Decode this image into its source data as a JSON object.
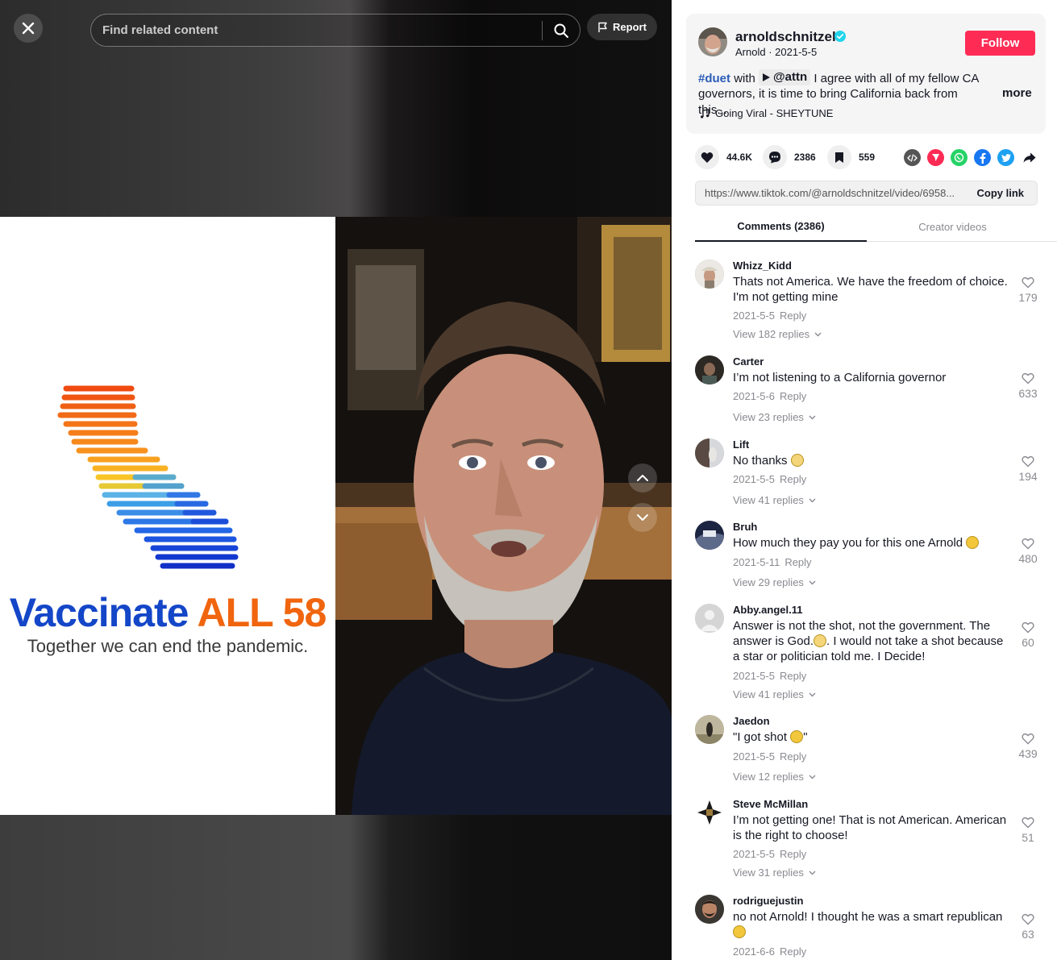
{
  "player": {
    "search_placeholder": "Find related content",
    "report_label": "Report",
    "video": {
      "campaign_title_part1": "Vaccinate",
      "campaign_title_part2": "ALL 58",
      "campaign_subtitle": "Together we can end the pandemic."
    }
  },
  "post": {
    "author": "arnoldschnitzel",
    "display_name": "Arnold",
    "date": "2021-5-5",
    "follow_label": "Follow",
    "caption_hashtag": "#duet",
    "caption_with": "with",
    "caption_mention": "@attn",
    "caption_text": "I agree with all of my fellow CA governors, it is time to bring California back from this...",
    "more_label": "more",
    "music": "Going Viral - SHEYTUNE",
    "likes": "44.6K",
    "comments_count": "2386",
    "bookmarks": "559",
    "share_targets": [
      "embed-icon",
      "send-icon",
      "whatsapp-icon",
      "facebook-icon",
      "twitter-icon",
      "share-arrow-icon"
    ],
    "link": "https://www.tiktok.com/@arnoldschnitzel/video/6958...",
    "copy_link_label": "Copy link"
  },
  "tabs": {
    "comments": "Comments (2386)",
    "creator": "Creator videos"
  },
  "comments": [
    {
      "user": "Whizz_Kidd",
      "text": "Thats not America. We have the freedom of choice. I'm not getting mine",
      "date": "2021-5-5",
      "reply": "Reply",
      "replies": "View 182 replies",
      "likes": "179"
    },
    {
      "user": "Carter",
      "text": "I’m not listening to a California governor",
      "date": "2021-5-6",
      "reply": "Reply",
      "replies": "View 23 replies",
      "likes": "633"
    },
    {
      "user": "Lift",
      "text": "No thanks",
      "date": "2021-5-5",
      "reply": "Reply",
      "replies": "View 41 replies",
      "likes": "194"
    },
    {
      "user": "Bruh",
      "text": "How much they pay you for this one Arnold",
      "date": "2021-5-11",
      "reply": "Reply",
      "replies": "View 29 replies",
      "likes": "480"
    },
    {
      "user": "Abby.angel.11",
      "text_a": "Answer is not the shot, not the government. The answer is God.",
      "text_b": ". I would not take a shot because a star or politician told me. I Decide!",
      "date": "2021-5-5",
      "reply": "Reply",
      "replies": "View 41 replies",
      "likes": "60"
    },
    {
      "user": "Jaedon",
      "text_a": "\"I got shot",
      "text_b": "\"",
      "date": "2021-5-5",
      "reply": "Reply",
      "replies": "View 12 replies",
      "likes": "439"
    },
    {
      "user": "Steve McMillan",
      "text": "I’m not getting one! That is not American. American is the right to choose!",
      "date": "2021-5-5",
      "reply": "Reply",
      "replies": "View 31 replies",
      "likes": "51"
    },
    {
      "user": "rodriguejustin",
      "text": "no not Arnold! I thought he was a smart republican",
      "date": "2021-6-6",
      "reply": "Reply",
      "likes": "63"
    }
  ],
  "colors": {
    "follow": "#fe2c55",
    "hashtag": "#2b5db9",
    "campaign_blue": "#1446c8",
    "campaign_orange": "#f0650e"
  }
}
